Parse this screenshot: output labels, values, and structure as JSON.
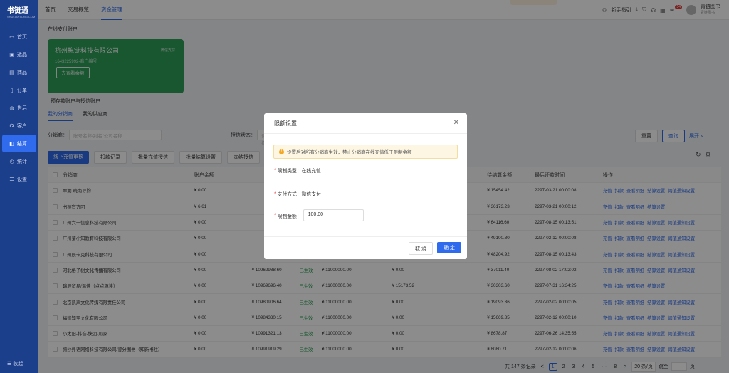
{
  "app": {
    "logo": "书链通",
    "logo_sub": "SHULIANTONG.COM"
  },
  "sidebar": {
    "items": [
      {
        "label": "首页",
        "icon": "home-icon",
        "glyph": "▭"
      },
      {
        "label": "选品",
        "icon": "select-icon",
        "glyph": "▣"
      },
      {
        "label": "商品",
        "icon": "goods-icon",
        "glyph": "▤"
      },
      {
        "label": "订单",
        "icon": "order-icon",
        "glyph": "▯"
      },
      {
        "label": "售后",
        "icon": "aftersale-icon",
        "glyph": "◍"
      },
      {
        "label": "客户",
        "icon": "customer-icon",
        "glyph": "☊"
      },
      {
        "label": "结算",
        "icon": "settlement-icon",
        "glyph": "◧"
      },
      {
        "label": "统计",
        "icon": "stats-icon",
        "glyph": "◷"
      },
      {
        "label": "设置",
        "icon": "settings-icon",
        "glyph": "☰"
      }
    ],
    "active_index": 6,
    "collapse": "☰ 收起"
  },
  "topnav": {
    "tabs": [
      "首页",
      "交易概览",
      "资金管理"
    ],
    "active_index": 2
  },
  "topright": {
    "guide": "新手指引",
    "badge": "54",
    "user": "青链图书",
    "user_sub": "青链图书"
  },
  "section1": "在线支付账户",
  "card": {
    "name": "杭州栋链科技有限公司",
    "tag": "微信支付",
    "no": "1643225992-商户编号",
    "button": "去查看余额"
  },
  "section2": "预存款账户与授信账户",
  "subtabs": [
    "我的分销商",
    "我的供应商"
  ],
  "filter": {
    "label1": "分销商：",
    "placeholder1": "账号名称/别名/公司名称",
    "label2": "授信状态：",
    "placeholder2": "请选择"
  },
  "filter_buttons": {
    "reset": "重置",
    "search": "查询",
    "expand": "展开 ∨"
  },
  "actions": [
    "线下充值审核",
    "扣款记录",
    "批量充值授信",
    "批量结算设置",
    "冻结授信"
  ],
  "table": {
    "headers": [
      "分销商",
      "账户余额",
      "",
      "",
      "",
      "",
      "",
      "待结算金额",
      "最后还款时间",
      "操作"
    ],
    "rows": [
      {
        "name": "翠湖-晓南导购",
        "bal": "¥ 0.00",
        "c3": "",
        "st": "",
        "c5": "",
        "c6": "",
        "c7": "",
        "pend": "¥ 15454.42",
        "time": "2297-03-21 00:00:08",
        "ops": [
          "充值",
          "扣款",
          "查看明细",
          "结算设置",
          "阈值通知设置"
        ]
      },
      {
        "name": "书链官方团",
        "bal": "¥ 6.61",
        "c3": "",
        "st": "",
        "c5": "",
        "c6": "",
        "c7": "",
        "pend": "¥ 36173.23",
        "time": "2297-03-21 00:00:12",
        "ops": [
          "充值",
          "扣款",
          "查看明细",
          "结算设置"
        ]
      },
      {
        "name": "广州六一信息科技有限公司",
        "bal": "¥ 0.00",
        "c3": "",
        "st": "",
        "c5": "",
        "c6": "",
        "c7": "",
        "pend": "¥ 64116.60",
        "time": "2297-08-15 00:13:51",
        "ops": [
          "充值",
          "扣款",
          "查看明细",
          "结算设置",
          "阈值通知设置"
        ]
      },
      {
        "name": "广州菊小知教育科技有限公司",
        "bal": "¥ 0.00",
        "c3": "",
        "st": "",
        "c5": "",
        "c6": "",
        "c7": "",
        "pend": "¥ 49100.80",
        "time": "2297-02-12 00:00:08",
        "ops": [
          "充值",
          "扣款",
          "查看明细",
          "结算设置",
          "阈值通知设置"
        ]
      },
      {
        "name": "广州辰卡克科技有限公司",
        "bal": "¥ 0.00",
        "c3": "",
        "st": "",
        "c5": "",
        "c6": "",
        "c7": "",
        "pend": "¥ 48204.92",
        "time": "2297-08-15 00:13:43",
        "ops": [
          "充值",
          "扣款",
          "查看明细",
          "结算设置",
          "阈值通知设置"
        ]
      },
      {
        "name": "河北格子树文化传播有限公司",
        "bal": "¥ 0.00",
        "c3": "¥ 10962988.60",
        "st": "已生效",
        "c5": "¥ 11000000.00",
        "c6": "¥ 0.00",
        "c7": "",
        "pend": "¥ 37011.40",
        "time": "2297-08-02 17:02:02",
        "ops": [
          "充值",
          "扣款",
          "查看明细",
          "结算设置",
          "阈值通知设置"
        ]
      },
      {
        "name": "瑞辰贸易/温佳（点点趣读）",
        "bal": "¥ 0.00",
        "c3": "¥ 10969696.40",
        "st": "已生效",
        "c5": "¥ 11000000.00",
        "c6": "¥ 15173.52",
        "c7": "",
        "pend": "¥ 30303.60",
        "time": "2297-07-31 16:34:25",
        "ops": [
          "充值",
          "扣款",
          "查看明细",
          "结算设置"
        ]
      },
      {
        "name": "北京凯声文化传媒有限责任公司",
        "bal": "¥ 0.00",
        "c3": "¥ 10980906.64",
        "st": "已生效",
        "c5": "¥ 11000000.00",
        "c6": "¥ 0.00",
        "c7": "",
        "pend": "¥ 19093.36",
        "time": "2297-02-02 00:00:05",
        "ops": [
          "充值",
          "扣款",
          "查看明细",
          "结算设置",
          "阈值通知设置"
        ]
      },
      {
        "name": "福建知至文化有限公司",
        "bal": "¥ 0.00",
        "c3": "¥ 10984330.15",
        "st": "已生效",
        "c5": "¥ 11000000.00",
        "c6": "¥ 0.00",
        "c7": "",
        "pend": "¥ 15669.85",
        "time": "2297-02-12 00:00:10",
        "ops": [
          "充值",
          "扣款",
          "查看明细",
          "结算设置",
          "阈值通知设置"
        ]
      },
      {
        "name": "小太阳-抖音-快团-瓜家",
        "bal": "¥ 0.00",
        "c3": "¥ 10991321.13",
        "st": "已生效",
        "c5": "¥ 11000000.00",
        "c6": "¥ 0.00",
        "c7": "",
        "pend": "¥ 8678.87",
        "time": "2297-06-26 14:35:55",
        "ops": [
          "充值",
          "扣款",
          "查看明细",
          "结算设置",
          "阈值通知设置"
        ]
      },
      {
        "name": "腾沙外语网络科技有限公司/睿分图书（知新书社）",
        "bal": "¥ 0.00",
        "c3": "¥ 10991919.29",
        "st": "已生效",
        "c5": "¥ 11000000.00",
        "c6": "¥ 0.00",
        "c7": "",
        "pend": "¥ 8080.71",
        "time": "2297-02-12 00:00:06",
        "ops": [
          "充值",
          "扣款",
          "查看明细",
          "结算设置",
          "阈值通知设置"
        ]
      }
    ]
  },
  "pagination": {
    "total": "共 147 条记录",
    "prev": "<",
    "pages": [
      "1",
      "2",
      "3",
      "4",
      "5",
      "···",
      "8"
    ],
    "next": ">",
    "size": "20 条/页",
    "jump": "跳至",
    "unit": "页"
  },
  "modal": {
    "title": "限额设置",
    "alert": "设置后对所有分销商生效，禁止分销商在线充值低于限制金额",
    "type_label": "限制类型：",
    "type_value": "在线充值",
    "pay_label": "支付方式：",
    "pay_value": "微信支付",
    "amount_label": "限制金额：",
    "amount_value": "100.00",
    "cancel": "取 消",
    "ok": "确 定"
  },
  "colors": {
    "sidebar": "#1c3f8c",
    "primary": "#2f6bec",
    "card": "#2d9e57"
  }
}
